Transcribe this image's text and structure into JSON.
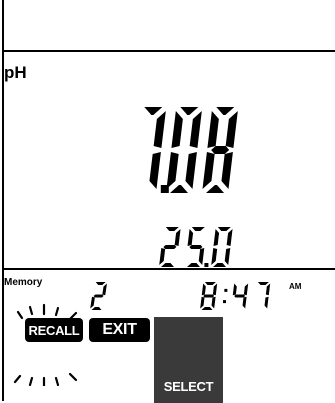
{
  "display": {
    "parameter_label": "pH",
    "main_reading": "7.08",
    "temperature_reading": "25.0"
  },
  "memory": {
    "label": "Memory",
    "location": "2",
    "time": "8:47",
    "time_period": "AM"
  },
  "keys": {
    "recall": "RECALL",
    "exit": "EXIT",
    "select": "SELECT"
  },
  "indicators": {
    "recall_blinking": true
  }
}
